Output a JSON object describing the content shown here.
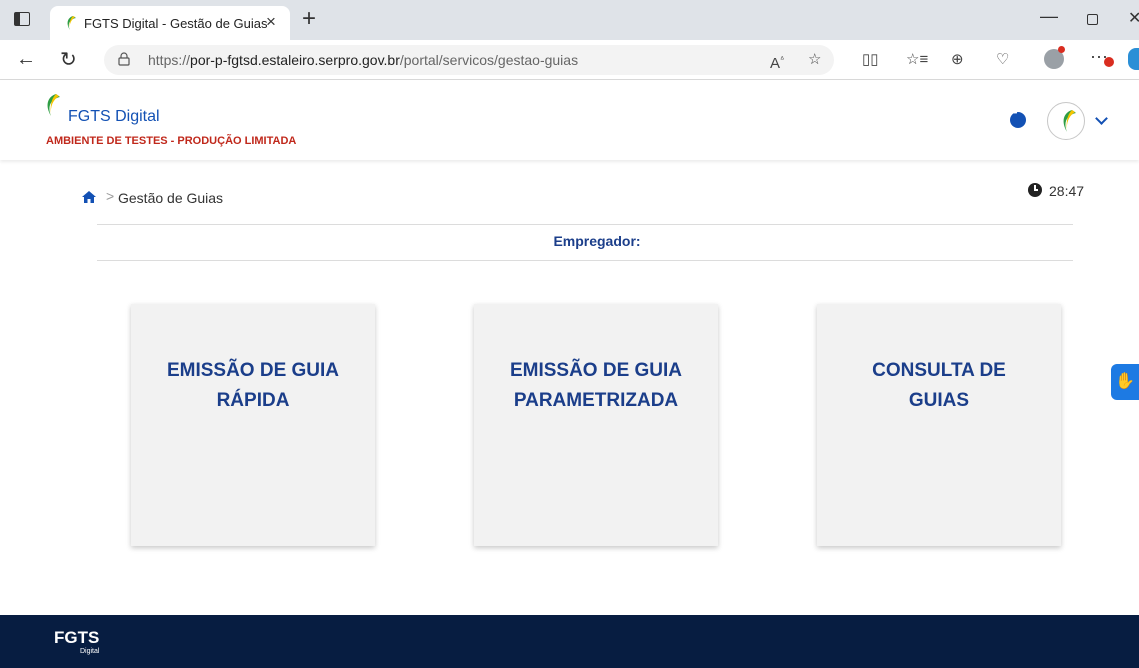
{
  "browser": {
    "tab_title": "FGTS Digital - Gestão de Guias",
    "tab_close": "×",
    "new_tab": "+",
    "url_prefix": "https://",
    "url_host": "por-p-fgtsd.estaleiro.serpro.gov.br",
    "url_path": "/portal/servicos/gestao-guias",
    "toolbar_icons": [
      "read-aloud-icon",
      "favorite-star-icon",
      "split-screen-icon",
      "favorites-icon",
      "collections-icon",
      "browser-essentials-icon",
      "profile-icon",
      "more-icon"
    ]
  },
  "header": {
    "title": "FGTS Digital",
    "environment": "AMBIENTE DE TESTES - PRODUÇÃO LIMITADA"
  },
  "breadcrumb": {
    "separator": ">",
    "current": "Gestão de Guias"
  },
  "session_timer": "28:47",
  "employer_label": "Empregador:",
  "cards": [
    {
      "line1": "EMISSÃO DE GUIA",
      "line2": "RÁPIDA"
    },
    {
      "line1": "EMISSÃO DE GUIA",
      "line2": "PARAMETRIZADA"
    },
    {
      "line1": "CONSULTA DE",
      "line2": "GUIAS"
    }
  ],
  "footer": {
    "logo": "FGTS",
    "logo_sub": "Digital"
  },
  "colors": {
    "brand_blue": "#1351b4",
    "card_title": "#1b3e8a",
    "env_red": "#c0281b",
    "footer_bg": "#071d41"
  }
}
